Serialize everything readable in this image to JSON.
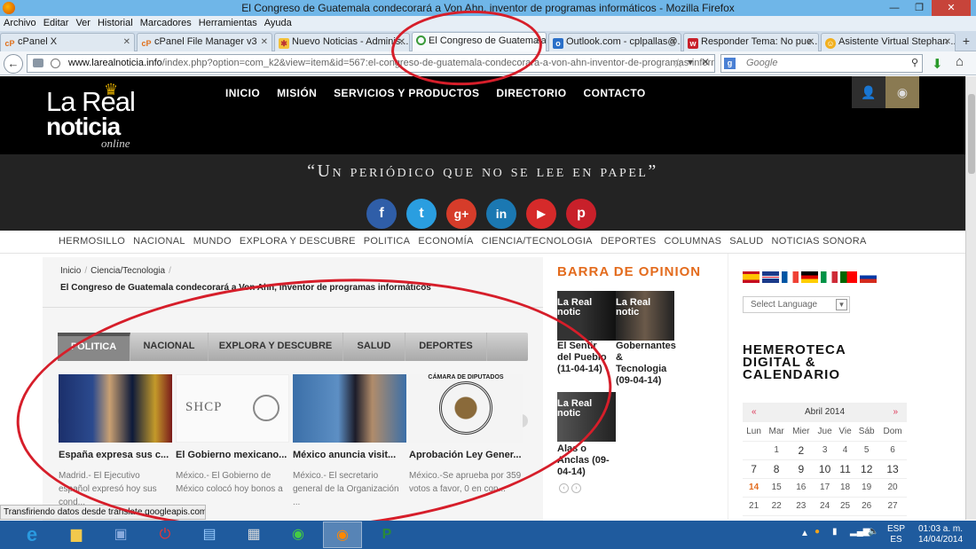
{
  "window": {
    "title": "El Congreso de Guatemala condecorará a Von Ahn, inventor de programas informáticos - Mozilla Firefox"
  },
  "menubar": [
    "Archivo",
    "Editar",
    "Ver",
    "Historial",
    "Marcadores",
    "Herramientas",
    "Ayuda"
  ],
  "tabs": [
    {
      "label": "cPanel X",
      "icon": "cpanel-icon"
    },
    {
      "label": "cPanel File Manager v3",
      "icon": "cpanel-icon"
    },
    {
      "label": "Nuevo Noticias - Adminis...",
      "icon": "joomla-icon"
    },
    {
      "label": "El Congreso de Guatemala...",
      "icon": "loading-icon",
      "active": true
    },
    {
      "label": "Outlook.com - cplpallas@...",
      "icon": "outlook-icon"
    },
    {
      "label": "Responder Tema: No pue...",
      "icon": "forum-icon"
    },
    {
      "label": "Asistente Virtual Stephan ...",
      "icon": "assistant-icon"
    }
  ],
  "navbar": {
    "url_domain": "www.larealnoticia.info",
    "url_path": "/index.php?option=com_k2&view=item&id=567:el-congreso-de-guatemala-condecorara-a-von-ahn-inventor-de-programas-informatico",
    "search_engine": "g",
    "search_placeholder": "Google"
  },
  "site": {
    "logo_line1": "La Real",
    "logo_line2": "noticia",
    "logo_line3": "online",
    "nav": [
      "INICIO",
      "MISIÓN",
      "SERVICIOS Y PRODUCTOS",
      "DIRECTORIO",
      "CONTACTO"
    ],
    "slogan": "“Un periódico que no se lee en papel”",
    "social": [
      {
        "name": "facebook",
        "glyph": "f",
        "color": "#2f5ea8"
      },
      {
        "name": "twitter",
        "glyph": "t",
        "color": "#2a9ee0"
      },
      {
        "name": "google-plus",
        "glyph": "g+",
        "color": "#d63c2a"
      },
      {
        "name": "linkedin",
        "glyph": "in",
        "color": "#1b78b2"
      },
      {
        "name": "youtube",
        "glyph": "▶",
        "color": "#d62a2a"
      },
      {
        "name": "pinterest",
        "glyph": "p",
        "color": "#c8202a"
      }
    ],
    "categories": [
      "HERMOSILLO",
      "NACIONAL",
      "MUNDO",
      "EXPLORA Y DESCUBRE",
      "POLITICA",
      "ECONOMÍA",
      "CIENCIA/TECNOLOGIA",
      "DEPORTES",
      "COLUMNAS",
      "SALUD",
      "NOTICIAS SONORA"
    ]
  },
  "article": {
    "breadcrumb": [
      "Inicio",
      "Ciencia/Tecnologia"
    ],
    "title": "El Congreso de Guatemala condecorará a Von Ahn, inventor de programas informáticos",
    "tabs": [
      "POLITICA",
      "NACIONAL",
      "EXPLORA Y DESCUBRE",
      "SALUD",
      "DEPORTES"
    ],
    "slides": [
      {
        "title": "España expresa sus c...",
        "body": "Madrid.- El Ejecutivo español expresó hoy sus cond..."
      },
      {
        "title": "El Gobierno mexicano...",
        "body": "México.- El Gobierno de México colocó hoy bonos a"
      },
      {
        "title": "México anuncia visit...",
        "body": "México.- El secretario general de la Organización ..."
      },
      {
        "title": "Aprobación Ley Gener...",
        "body": "México.-Se aprueba por 359 votos a favor, 0 en con..."
      }
    ],
    "shcp_label": "SHCP",
    "camara_label": "CÁMARA DE DIPUTADOS"
  },
  "opinion": {
    "heading": "BARRA DE OPINION",
    "img_label": "La Real notic",
    "items": [
      {
        "caption": "El Sentir del Pueblo (11-04-14)"
      },
      {
        "caption": "Gobernantes & Tecnologia (09-04-14)"
      },
      {
        "caption": "Alas o Anclas (09-04-14)"
      }
    ]
  },
  "sidebar": {
    "language_placeholder": "Select Language",
    "hemeroteca": "HEMEROTECA DIGITAL & CALENDARIO",
    "calendar": {
      "month": "Abril 2014",
      "prev": "«",
      "next": "»",
      "weekdays": [
        "Lun",
        "Mar",
        "Mier",
        "Jue",
        "Vie",
        "Sáb",
        "Dom"
      ],
      "weeks": [
        [
          "",
          "1",
          "2",
          "3",
          "4",
          "5",
          "6"
        ],
        [
          "7",
          "8",
          "9",
          "10",
          "11",
          "12",
          "13"
        ],
        [
          "14",
          "15",
          "16",
          "17",
          "18",
          "19",
          "20"
        ],
        [
          "21",
          "22",
          "23",
          "24",
          "25",
          "26",
          "27"
        ]
      ]
    }
  },
  "status": {
    "text": "Transfiriendo datos desde translate.googleapis.com..."
  },
  "taskbar": {
    "lang_line1": "ESP",
    "lang_line2": "ES",
    "time": "01:03 a. m.",
    "date": "14/04/2014"
  },
  "colors": {
    "accent_orange": "#e36b1d",
    "annotation_red": "#d61e2a",
    "taskbar_blue": "#1f5b9e"
  }
}
